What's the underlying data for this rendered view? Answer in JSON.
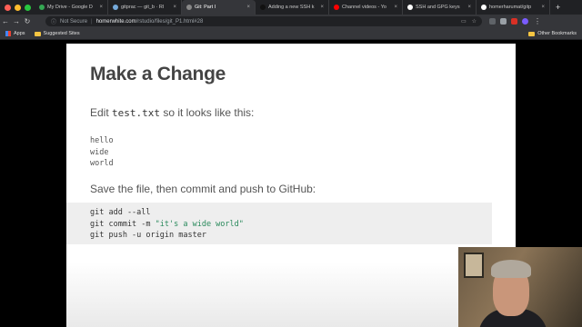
{
  "browser": {
    "tabs": [
      {
        "label": "My Drive - Google D",
        "icon_color": "#34a853"
      },
      {
        "label": "gitprac — git_b · Rl",
        "icon_color": "#75aadb"
      },
      {
        "label": "Git: Part I",
        "icon_color": "#888888",
        "active": true
      },
      {
        "label": "Adding a new SSH k",
        "icon_color": "#111111"
      },
      {
        "label": "Channel videos - Yo",
        "icon_color": "#ff0000"
      },
      {
        "label": "SSH and GPG keys",
        "icon_color": "#ffffff"
      },
      {
        "label": "homerharumat/gitp",
        "icon_color": "#ffffff"
      }
    ],
    "tab_close": "×",
    "new_tab": "+",
    "nav": {
      "back": "←",
      "forward": "→",
      "reload": "↻"
    },
    "security_label": "Not Secure",
    "url_host": "homerwhite.com",
    "url_path": "/rstudio/files/git_P1.html#28",
    "bookmarks": {
      "apps": "Apps",
      "suggested": "Suggested Sites",
      "other": "Other Bookmarks"
    }
  },
  "slide": {
    "title": "Make a Change",
    "edit_pre": "Edit ",
    "edit_file": "test.txt",
    "edit_post": " so it looks like this:",
    "file_lines": [
      "hello",
      "wide",
      "world"
    ],
    "instruction": "Save the file, then commit and push to GitHub:",
    "code": {
      "line1": "git add --all",
      "line2_pre": "git commit -m ",
      "line2_str": "\"it's a wide world\"",
      "line3": "git push -u origin master"
    }
  },
  "colors": {
    "accent_string": "#2a8a5c",
    "slide_bg": "#ffffff",
    "code_bg": "#eeeeee"
  }
}
